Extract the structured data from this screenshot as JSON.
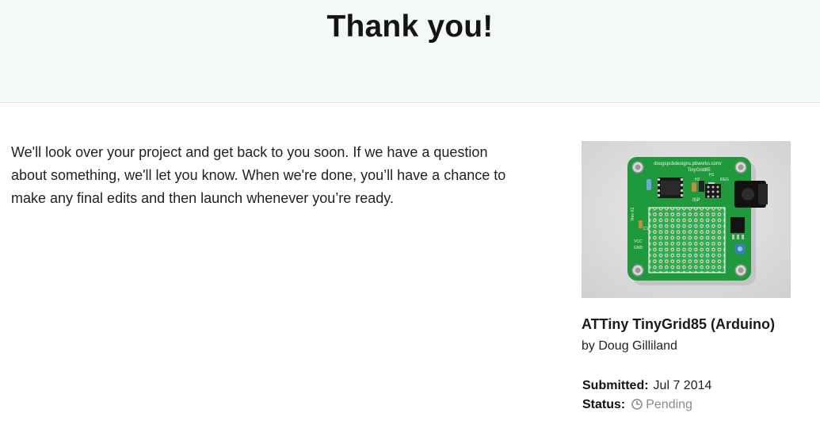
{
  "header": {
    "title": "Thank you!"
  },
  "message": "We'll look over your project and get back to you soon. If we have a question about something, we'll let you know. When we're done, you’ll have a chance to make any final edits and then launch whenever you’re ready.",
  "project": {
    "title": "ATTiny TinyGrid85 (Arduino)",
    "author": "by Doug Gilliland",
    "image_alt": "TinyGrid85 circuit board photo",
    "board_text": {
      "url": "dougspcbdesigns.pbworks.com/",
      "name": "TinyGrid85",
      "isp": "ISP",
      "c1": "C1",
      "rev": "Rev X1",
      "vcc": "VCC",
      "gnd": "GND",
      "h1": "H1",
      "h2": "H2",
      "reg": "REG"
    }
  },
  "meta": {
    "submitted_label": "Submitted:",
    "submitted_value": "Jul 7 2014",
    "status_label": "Status:",
    "status_value": "Pending"
  },
  "colors": {
    "header_bg": "#f5f8f9",
    "pcb_green": "#1e9a3c",
    "status_gray": "#8a8a8a"
  },
  "icons": {
    "status": "clock-icon"
  }
}
